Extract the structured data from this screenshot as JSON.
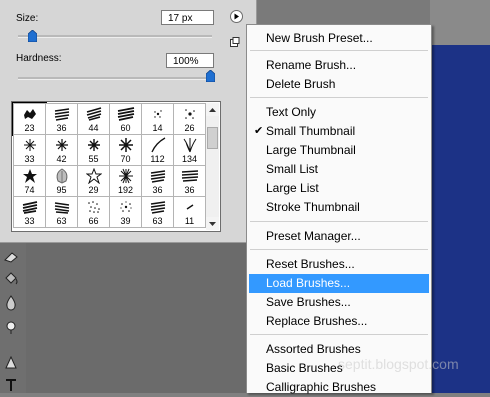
{
  "panel": {
    "size_label": "Size:",
    "size_value": "17 px",
    "hardness_label": "Hardness:",
    "hardness_value": "100%",
    "brushes": [
      {
        "num": "23"
      },
      {
        "num": "36"
      },
      {
        "num": "44"
      },
      {
        "num": "60"
      },
      {
        "num": "14"
      },
      {
        "num": "26"
      },
      {
        "num": "33"
      },
      {
        "num": "42"
      },
      {
        "num": "55"
      },
      {
        "num": "70"
      },
      {
        "num": "112"
      },
      {
        "num": "134"
      },
      {
        "num": "74"
      },
      {
        "num": "95"
      },
      {
        "num": "29"
      },
      {
        "num": "192"
      },
      {
        "num": "36"
      },
      {
        "num": "36"
      },
      {
        "num": "33"
      },
      {
        "num": "63"
      },
      {
        "num": "66"
      },
      {
        "num": "39"
      },
      {
        "num": "63"
      },
      {
        "num": "11"
      }
    ]
  },
  "menu": {
    "items": [
      {
        "label": "New Brush Preset..."
      },
      {
        "label": "Rename Brush..."
      },
      {
        "label": "Delete Brush"
      },
      {
        "label": "Text Only"
      },
      {
        "label": "Small Thumbnail",
        "checked": "✔"
      },
      {
        "label": "Large Thumbnail"
      },
      {
        "label": "Small List"
      },
      {
        "label": "Large List"
      },
      {
        "label": "Stroke Thumbnail"
      },
      {
        "label": "Preset Manager..."
      },
      {
        "label": "Reset Brushes..."
      },
      {
        "label": "Load Brushes..."
      },
      {
        "label": "Save Brushes..."
      },
      {
        "label": "Replace Brushes..."
      },
      {
        "label": "Assorted Brushes"
      },
      {
        "label": "Basic Brushes"
      },
      {
        "label": "Calligraphic Brushes"
      }
    ]
  },
  "watermark": "septit.blogspot.com",
  "colors": {
    "highlight": "#3399ff",
    "canvas": "#1c3286"
  }
}
